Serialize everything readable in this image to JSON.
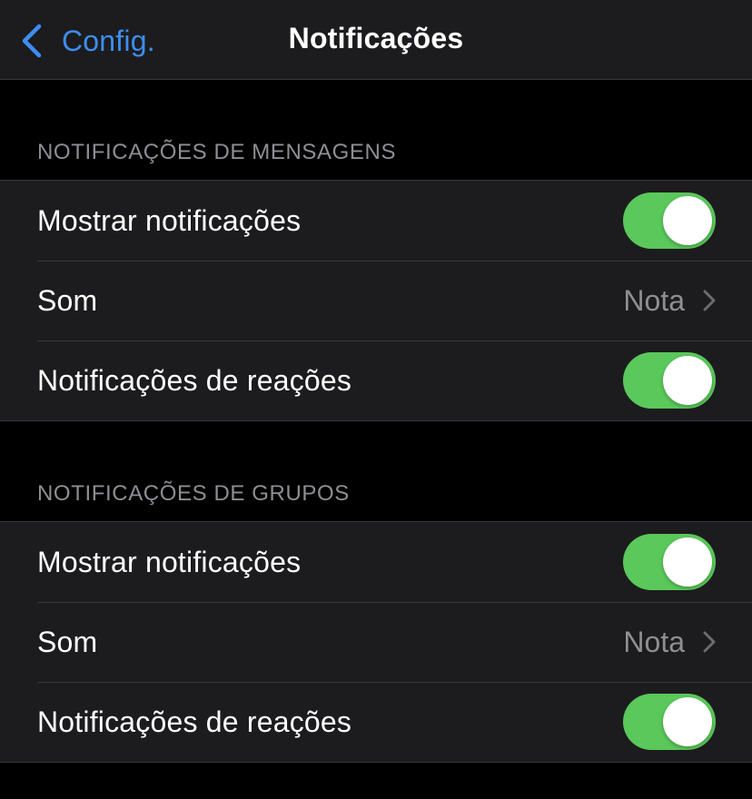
{
  "nav": {
    "back_label": "Config.",
    "title": "Notificações"
  },
  "colors": {
    "accent": "#3d8ef0",
    "toggle_on": "#5ac85a",
    "background": "#000000",
    "cell": "#1c1c1e",
    "secondary_text": "#8e8e93"
  },
  "icons": {
    "back": "chevron-left-icon",
    "disclosure": "chevron-right-icon"
  },
  "sections": [
    {
      "header": "NOTIFICAÇÕES DE MENSAGENS",
      "show_notifications": {
        "label": "Mostrar notificações",
        "on": true
      },
      "sound": {
        "label": "Som",
        "value": "Nota"
      },
      "reactions": {
        "label": "Notificações de reações",
        "on": true
      }
    },
    {
      "header": "NOTIFICAÇÕES DE GRUPOS",
      "show_notifications": {
        "label": "Mostrar notificações",
        "on": true
      },
      "sound": {
        "label": "Som",
        "value": "Nota"
      },
      "reactions": {
        "label": "Notificações de reações",
        "on": true
      }
    }
  ]
}
